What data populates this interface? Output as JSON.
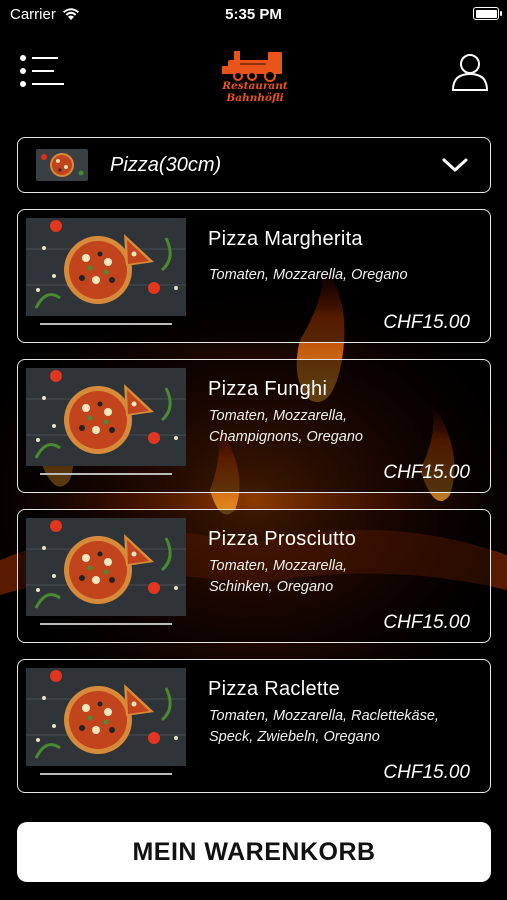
{
  "status_bar": {
    "carrier": "Carrier",
    "time": "5:35 PM"
  },
  "header": {
    "logo_line1": "Restaurant",
    "logo_line2": "Bahnhöfli"
  },
  "category": {
    "label": "Pizza(30cm)"
  },
  "products": [
    {
      "name": "Pizza Margherita",
      "description_lines": [
        "Tomaten, Mozzarella, Oregano"
      ],
      "price": "CHF15.00"
    },
    {
      "name": "Pizza Funghi",
      "description_lines": [
        "Tomaten, Mozzarella,",
        "Champignons, Oregano"
      ],
      "price": "CHF15.00"
    },
    {
      "name": "Pizza Prosciutto",
      "description_lines": [
        "Tomaten, Mozzarella,",
        "Schinken, Oregano"
      ],
      "price": "CHF15.00"
    },
    {
      "name": "Pizza Raclette",
      "description_lines": [
        "Tomaten, Mozzarella, Raclettekäse,",
        "Speck, Zwiebeln, Oregano"
      ],
      "price": "CHF15.00"
    }
  ],
  "cart_button": {
    "label": "MEIN WARENKORB"
  },
  "colors": {
    "background": "#000000",
    "border": "#e6e6e6",
    "logo": "#e8541a",
    "button_bg": "#ffffff",
    "button_text": "#111111"
  },
  "icons": {
    "menu": "list-menu-icon",
    "user": "user-icon",
    "chevron": "chevron-down-icon",
    "wifi": "wifi-icon",
    "battery": "battery-icon"
  }
}
